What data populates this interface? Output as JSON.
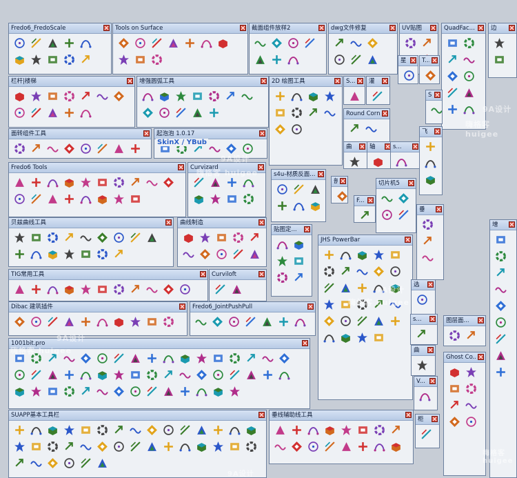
{
  "watermark": {
    "site_text": "9A设计",
    "site_text_2": "嗨格客 huigee",
    "brand": "9A设计"
  },
  "toolbars": [
    {
      "title": "Fredo6_FredoScale"
    },
    {
      "title": "Tools on Surface"
    },
    {
      "title": "截面组件放样2"
    },
    {
      "title": "dwg文件修复"
    },
    {
      "title": "UV贴图"
    },
    {
      "title": "QuadFac..."
    },
    {
      "title": "边"
    },
    {
      "title": "栏杆|楼梯"
    },
    {
      "title": "增强圆弧工具"
    },
    {
      "title": "2D 绘图工具"
    },
    {
      "title": "S..."
    },
    {
      "title": "灌"
    },
    {
      "title": "星"
    },
    {
      "title": "T..."
    },
    {
      "title": "S..."
    },
    {
      "title": "Round Corner"
    },
    {
      "title": "面转组件工具"
    },
    {
      "title": "起泡泡 1.0.17"
    },
    {
      "title": "曲"
    },
    {
      "title": "轴"
    },
    {
      "title": "s..."
    },
    {
      "title": "飞"
    },
    {
      "title": "Fredo6 Tools"
    },
    {
      "title": "Curvizard"
    },
    {
      "title": "s4u-材质反面..."
    },
    {
      "title": "剖"
    },
    {
      "title": "切片机5"
    },
    {
      "title": "F..."
    },
    {
      "title": "垂"
    },
    {
      "title": "增"
    },
    {
      "title": "贝兹曲线工具"
    },
    {
      "title": "曲线制造"
    },
    {
      "title": "贴图定..."
    },
    {
      "title": "JHS PowerBar"
    },
    {
      "title": "TIG常用工具"
    },
    {
      "title": "Curviloft"
    },
    {
      "title": "选"
    },
    {
      "title": "Dibac 建筑插件"
    },
    {
      "title": "Fredo6_JointPushPull"
    },
    {
      "title": "s..."
    },
    {
      "title": "图层面..."
    },
    {
      "title": "1001bit.pro"
    },
    {
      "title": "曲"
    },
    {
      "title": "Ghost Co..."
    },
    {
      "title": "V..."
    },
    {
      "title": "SUAPP基本工具栏"
    },
    {
      "title": "垂线辅助线工具"
    },
    {
      "title": "柜"
    }
  ],
  "bubble_labels": {
    "skin": "SkinX / YBub"
  },
  "accent_colors": {
    "title_bar": "#b8cbe6",
    "close": "#d84a3a",
    "canvas": "#c7cdd6"
  }
}
